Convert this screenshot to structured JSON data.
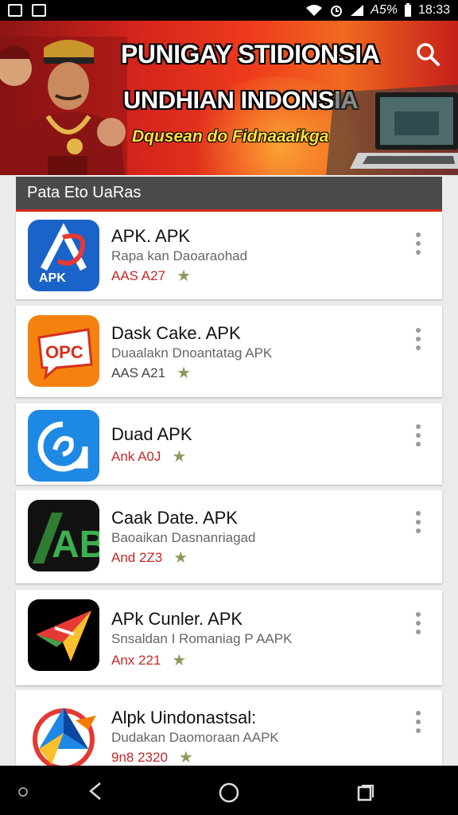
{
  "status_bar": {
    "battery": "A5%",
    "time": "18:33"
  },
  "banner": {
    "title_line1": "PUNIGAY STIDIONSIA",
    "title_line2": "UNDHIAN INDONSIA",
    "subtitle": "Dqusean do Fidnaaaikga"
  },
  "list_header": "Pata Eto UaRas",
  "apps": [
    {
      "title": "APK. APK",
      "subtitle": "Rapa kan Daoaraohad",
      "meta": "AAS A27",
      "icon_text": "APK",
      "icon": "apk-logo-icon"
    },
    {
      "title": "Dask Cake. APK",
      "subtitle": "Duaalakn Dnoantatag APK",
      "meta": "AAS A21",
      "icon_text": "OPC",
      "icon": "opc-chat-icon"
    },
    {
      "title": "Duad APK",
      "subtitle": "",
      "meta": "Ank A0J",
      "icon_text": "",
      "icon": "swirl-icon"
    },
    {
      "title": "Caak Date. APK",
      "subtitle": "Baoaikan Dasnanriagad",
      "meta": "And 2Z3",
      "icon_text": "AB",
      "icon": "ab-logo-icon"
    },
    {
      "title": "APk Cunler. APK",
      "subtitle": "Snsaldan I Romaniag P AAPK",
      "meta": "Anx 221",
      "icon_text": "",
      "icon": "paper-plane-icon"
    },
    {
      "title": "Alpk Uindonastsal:",
      "subtitle": "Dudakan Daomoraan AAPK",
      "meta": "9n8 2320",
      "icon_text": "",
      "icon": "compass-star-icon"
    }
  ],
  "colors": {
    "accent": "#d92b20",
    "header": "#4a4a4a",
    "meta": "#c62828",
    "star": "#8c9a5b"
  }
}
